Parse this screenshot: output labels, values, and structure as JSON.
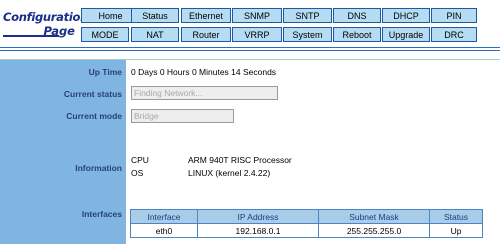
{
  "logo": {
    "line1": "Configuration",
    "line2": "Page"
  },
  "nav": {
    "row1": [
      "Home",
      "Status",
      "Ethernet",
      "SNMP",
      "SNTP",
      "DNS",
      "DHCP",
      "PIN"
    ],
    "row2": [
      "MODE",
      "NAT",
      "Router",
      "VRRP",
      "System",
      "Reboot",
      "Upgrade",
      "DRC"
    ]
  },
  "status": {
    "uptime_label": "Up Time",
    "uptime_value": "0 Days 0 Hours 0 Minutes 14 Seconds",
    "current_status_label": "Current status",
    "current_status_value": "Finding Network...",
    "current_mode_label": "Current mode",
    "current_mode_value": "Bridge",
    "information_label": "Information",
    "info": [
      {
        "key": "CPU",
        "value": "ARM 940T RISC Processor"
      },
      {
        "key": "OS",
        "value": "LINUX (kernel 2.4.22)"
      }
    ],
    "interfaces_label": "Interfaces"
  },
  "interfaces_table": {
    "headers": [
      "Interface",
      "IP Address",
      "Subnet Mask",
      "Status"
    ],
    "rows": [
      [
        "eth0",
        "192.168.0.1",
        "255.255.255.0",
        "Up"
      ]
    ]
  },
  "colors": {
    "sidebar": "#7fb5e0",
    "nav_button": "#b5dcf2",
    "nav_border": "#1d5aa3",
    "logo": "#1a2f86",
    "label": "#2b3f7a",
    "table_header": "#a9cce8"
  }
}
